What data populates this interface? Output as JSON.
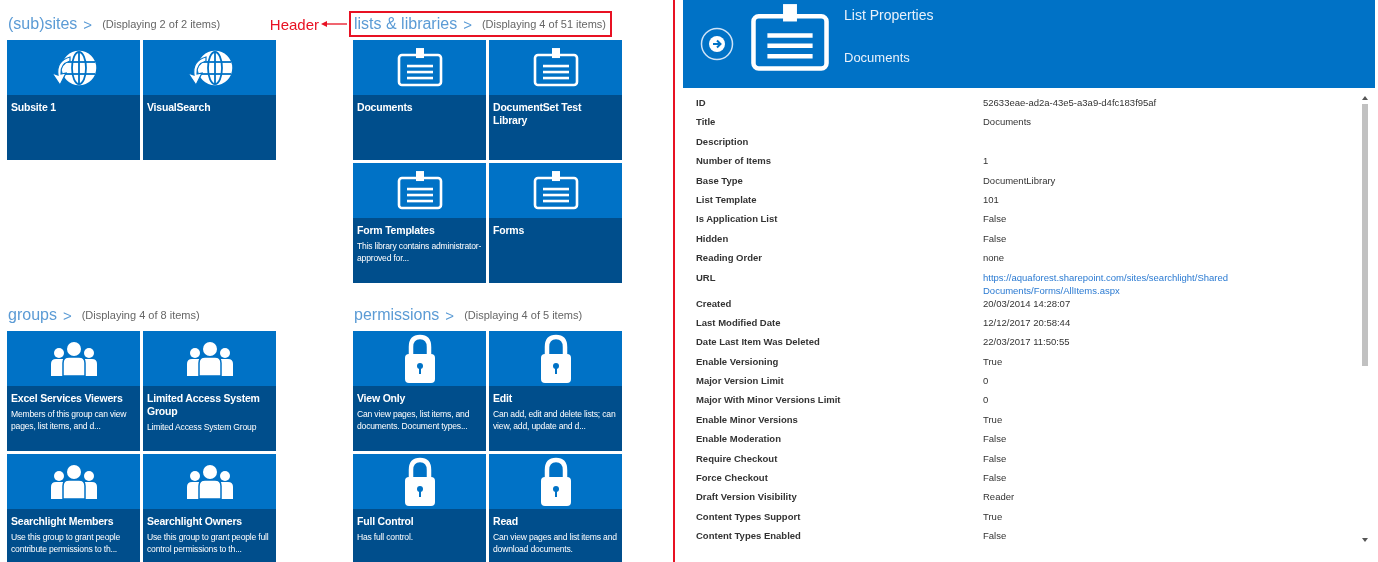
{
  "sections": [
    {
      "title": "(sub)sites",
      "chevron": ">",
      "count": "(Displaying 2 of 2 items)",
      "highlighted": false,
      "kind": "site",
      "tiles": [
        {
          "title": "Subsite 1"
        },
        {
          "title": "VisualSearch"
        }
      ]
    },
    {
      "title": "lists & libraries",
      "chevron": ">",
      "count": "(Displaying 4 of 51 items)",
      "highlighted": true,
      "annotation": "Header",
      "kind": "library",
      "tiles": [
        {
          "title": "Documents"
        },
        {
          "title": "DocumentSet Test Library"
        },
        {
          "title": "Form Templates",
          "description": "This library contains administrator-approved for..."
        },
        {
          "title": "Forms"
        }
      ]
    },
    {
      "title": "groups",
      "chevron": ">",
      "count": "(Displaying 4 of 8 items)",
      "highlighted": false,
      "kind": "group",
      "tiles": [
        {
          "title": "Excel Services Viewers",
          "description": "Members of this group can view pages, list items, and d..."
        },
        {
          "title": "Limited Access System Group",
          "description": "Limited Access System Group"
        },
        {
          "title": "Searchlight Members",
          "description": "Use this group to grant people contribute permissions to th..."
        },
        {
          "title": "Searchlight Owners",
          "description": "Use this group to grant people full control permissions to th..."
        }
      ]
    },
    {
      "title": "permissions",
      "chevron": ">",
      "count": "(Displaying 4 of 5 items)",
      "highlighted": false,
      "kind": "permission",
      "tiles": [
        {
          "title": "View Only",
          "description": "Can view pages, list items, and documents. Document types..."
        },
        {
          "title": "Edit",
          "description": "Can add, edit and delete lists; can view, add, update and d..."
        },
        {
          "title": "Full Control",
          "description": "Has full control."
        },
        {
          "title": "Read",
          "description": "Can view pages and list items and download documents."
        }
      ]
    }
  ],
  "panel": {
    "heading": "List Properties",
    "subtitle": "Documents",
    "properties": [
      {
        "label": "ID",
        "value": "52633eae-ad2a-43e5-a3a9-d4fc183f95af"
      },
      {
        "label": "Title",
        "value": "Documents"
      },
      {
        "label": "Description"
      },
      {
        "label": "Number of Items",
        "value": "1"
      },
      {
        "label": "Base Type",
        "value": "DocumentLibrary"
      },
      {
        "label": "List Template",
        "value": "101"
      },
      {
        "label": "Is Application List",
        "value": "False"
      },
      {
        "label": "Hidden",
        "value": "False"
      },
      {
        "label": "Reading Order",
        "value": "none"
      },
      {
        "label": "URL",
        "value": "https://aquaforest.sharepoint.com/sites/searchlight/Shared Documents/Forms/AllItems.aspx",
        "kind": "link"
      },
      {
        "label": "Created",
        "value": "20/03/2014 14:28:07"
      },
      {
        "label": "Last Modified Date",
        "value": "12/12/2017 20:58:44"
      },
      {
        "label": "Date Last Item Was Deleted",
        "value": "22/03/2017 11:50:55"
      },
      {
        "label": "Enable Versioning",
        "value": "True"
      },
      {
        "label": "Major Version Limit",
        "value": "0"
      },
      {
        "label": "Major With Minor Versions Limit",
        "value": "0"
      },
      {
        "label": "Enable Minor Versions",
        "value": "True"
      },
      {
        "label": "Enable Moderation",
        "value": "False"
      },
      {
        "label": "Require Checkout",
        "value": "False"
      },
      {
        "label": "Force Checkout",
        "value": "False"
      },
      {
        "label": "Draft Version Visibility",
        "value": "Reader"
      },
      {
        "label": "Content Types Support",
        "value": "True"
      },
      {
        "label": "Content Types Enabled",
        "value": "False"
      }
    ]
  }
}
